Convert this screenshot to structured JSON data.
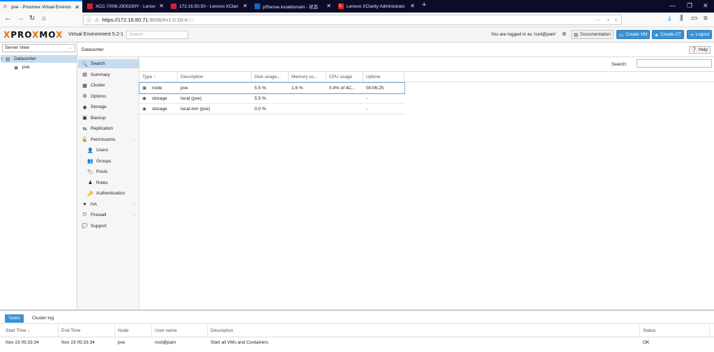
{
  "browser": {
    "tabs": [
      {
        "label": "pve - Proxmox Virtual Environ",
        "icon": "proxmox-icon",
        "active": true
      },
      {
        "label": "XCC-7X06-J300230Y - Lenov",
        "icon": "xcc-icon",
        "active": false
      },
      {
        "label": "172.16.50.50 - Lenovo XClari",
        "icon": "xcc-icon",
        "active": false
      },
      {
        "label": "pfSense.localdomain - 状态",
        "icon": "pfsense-icon",
        "active": false
      },
      {
        "label": "Lenovo XClarity Administrato",
        "icon": "lenovo-icon",
        "active": false
      }
    ],
    "new_tab": "+",
    "url_host": "https://172.16.80.71",
    "url_rest": ":8006/#v1:0:18:4:::::",
    "window_controls": [
      "—",
      "❐",
      "✕"
    ]
  },
  "header": {
    "logo_pro": "PRO",
    "logo_x": "X",
    "logo_mo": "MO",
    "logo_x2": "X",
    "version": "Virtual Environment 5.2-1",
    "search_placeholder": "Search",
    "logged_in": "You are logged in as 'root@pam'",
    "documentation": "Documentation",
    "create_vm": "Create VM",
    "create_ct": "Create CT",
    "logout": "Logout"
  },
  "tree": {
    "view": "Server View",
    "items": [
      {
        "label": "Datacenter",
        "icon": "datacenter-icon"
      },
      {
        "label": "pve",
        "icon": "node-icon"
      }
    ]
  },
  "content": {
    "breadcrumb": "Datacenter",
    "help": "Help",
    "menu": [
      {
        "label": "Search",
        "icon": "search-icon",
        "glyph": "🔍"
      },
      {
        "label": "Summary",
        "icon": "book-icon",
        "glyph": "▤"
      },
      {
        "label": "Cluster",
        "icon": "server-icon",
        "glyph": "▦"
      },
      {
        "label": "Options",
        "icon": "gear-icon",
        "glyph": "⚙"
      },
      {
        "label": "Storage",
        "icon": "database-icon",
        "glyph": "◉"
      },
      {
        "label": "Backup",
        "icon": "save-icon",
        "glyph": "▣"
      },
      {
        "label": "Replication",
        "icon": "retweet-icon",
        "glyph": "⇆"
      },
      {
        "label": "Permissions",
        "icon": "unlock-icon",
        "glyph": "🔓"
      },
      {
        "label": "Users",
        "icon": "user-icon",
        "glyph": "👤"
      },
      {
        "label": "Groups",
        "icon": "users-icon",
        "glyph": "👥"
      },
      {
        "label": "Pools",
        "icon": "tags-icon",
        "glyph": "🏷"
      },
      {
        "label": "Roles",
        "icon": "male-icon",
        "glyph": "♟"
      },
      {
        "label": "Authentication",
        "icon": "key-icon",
        "glyph": "🔑"
      },
      {
        "label": "HA",
        "icon": "heartbeat-icon",
        "glyph": "♥"
      },
      {
        "label": "Firewall",
        "icon": "shield-icon",
        "glyph": "⛉"
      },
      {
        "label": "Support",
        "icon": "comments-icon",
        "glyph": "💬"
      }
    ],
    "search_label": "Search:",
    "columns": [
      "Type ↑",
      "Description",
      "Disk usage...",
      "Memory us...",
      "CPU usage",
      "Uptime"
    ],
    "rows": [
      {
        "type": "node",
        "description": "pve",
        "disk": "5.5 %",
        "memory": "1.6 %",
        "cpu": "0.4% of 4C...",
        "uptime": "00:06:25"
      },
      {
        "type": "storage",
        "description": "local (pve)",
        "disk": "5.5 %",
        "memory": "",
        "cpu": "",
        "uptime": "-"
      },
      {
        "type": "storage",
        "description": "local-lvm (pve)",
        "disk": "0.0 %",
        "memory": "",
        "cpu": "",
        "uptime": "-"
      }
    ]
  },
  "tasks": {
    "tabs": [
      "Tasks",
      "Cluster log"
    ],
    "columns": [
      "Start Time ↓",
      "End Time",
      "Node",
      "User name",
      "Description",
      "Status"
    ],
    "rows": [
      {
        "start": "Nov 23 05:33:34",
        "end": "Nov 23 05:33:34",
        "node": "pve",
        "user": "root@pam",
        "description": "Start all VMs and Containers",
        "status": "OK"
      }
    ]
  }
}
